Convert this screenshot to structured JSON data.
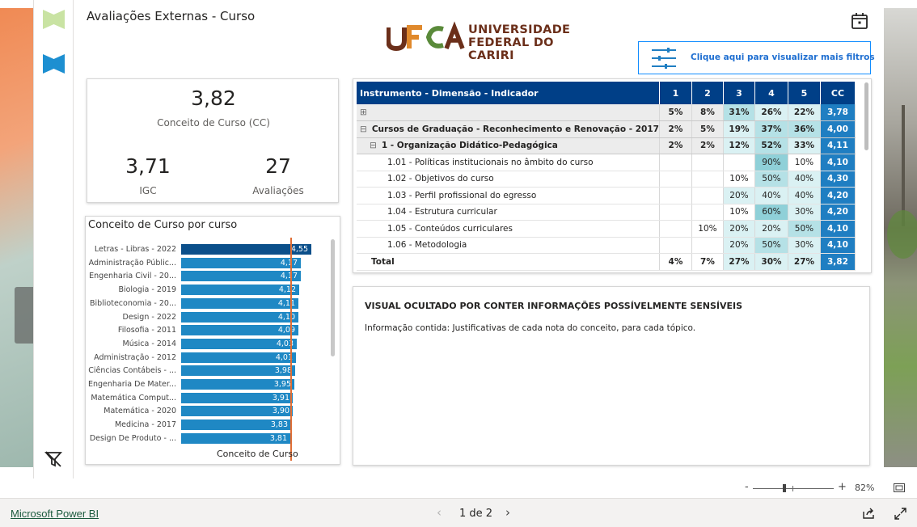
{
  "report": {
    "title": "Avaliações Externas - Curso",
    "logo_text_line1": "UNIVERSIDADE",
    "logo_text_line2": "FEDERAL DO CARIRI",
    "logo_mark": "UFCA",
    "filter_button_label": "Clique aqui para visualizar mais filtros"
  },
  "colors": {
    "primary": "#003f87",
    "bar": "#1f88c4",
    "bar_top": "#0b4f8a",
    "reference_line": "#e06d34",
    "logo_brown": "#6b2f1a",
    "logo_orange": "#e0892c",
    "logo_green": "#5a8a3a"
  },
  "nav": {
    "icons": [
      "bookmark-light-green-icon",
      "bookmark-blue-icon",
      "clear-filter-icon"
    ]
  },
  "kpi": {
    "cc_value": "3,82",
    "cc_label": "Conceito de Curso (CC)",
    "igc_value": "3,71",
    "igc_label": "IGC",
    "avaliacoes_value": "27",
    "avaliacoes_label": "Avaliações"
  },
  "chart_data": {
    "type": "bar",
    "orientation": "horizontal",
    "title": "Conceito de Curso por curso",
    "xlabel": "Conceito de Curso",
    "categories": [
      "Letras - Libras - 2022",
      "Administração Públic...",
      "Engenharia Civil - 20...",
      "Biologia - 2019",
      "Biblioteconomia - 20...",
      "Design - 2022",
      "Filosofia - 2011",
      "Música - 2014",
      "Administração - 2012",
      "Ciências Contábeis - ...",
      "Engenharia De Mater...",
      "Matemática Comput...",
      "Matemática - 2020",
      "Medicina - 2017",
      "Design De Produto - ..."
    ],
    "values": [
      4.55,
      4.17,
      4.17,
      4.12,
      4.11,
      4.1,
      4.09,
      4.03,
      4.01,
      3.98,
      3.95,
      3.91,
      3.9,
      3.83,
      3.81
    ],
    "value_labels": [
      "4,55",
      "4,17",
      "4,17",
      "4,12",
      "4,11",
      "4,10",
      "4,09",
      "4,03",
      "4,01",
      "3,98",
      "3,95",
      "3,91",
      "3,90",
      "3,83",
      "3,81"
    ],
    "reference_line": 3.82,
    "xlim": [
      0,
      4.55
    ]
  },
  "matrix": {
    "headers": [
      "Instrumento - Dimensão - Indicador",
      "1",
      "2",
      "3",
      "4",
      "5",
      "CC"
    ],
    "rows": [
      {
        "kind": "grp",
        "label": "",
        "toggle": "⊞",
        "cells": [
          "5%",
          "8%",
          "31%",
          "26%",
          "22%"
        ],
        "heat": [
          "",
          "",
          "h2",
          "h1",
          "h1"
        ],
        "cc": "3,78"
      },
      {
        "kind": "grp",
        "label": "Cursos de Graduação - Reconhecimento e Renovação - 2017",
        "toggle": "⊟",
        "cells": [
          "2%",
          "5%",
          "19%",
          "37%",
          "36%"
        ],
        "heat": [
          "",
          "",
          "h1",
          "h2",
          "h2"
        ],
        "cc": "4,00"
      },
      {
        "kind": "grp",
        "label": "1 - Organização Didático-Pedagógica",
        "toggle": "⊟",
        "cells": [
          "2%",
          "2%",
          "12%",
          "52%",
          "33%"
        ],
        "heat": [
          "",
          "",
          "h1",
          "h2",
          "h1"
        ],
        "cc": "4,11"
      },
      {
        "kind": "leaf",
        "label": "1.01 - Políticas institucionais no âmbito do curso",
        "cells": [
          "",
          "",
          "",
          "90%",
          "10%"
        ],
        "heat": [
          "",
          "",
          "",
          "h3",
          ""
        ],
        "cc": "4,10"
      },
      {
        "kind": "leaf",
        "label": "1.02 - Objetivos do curso",
        "cells": [
          "",
          "",
          "10%",
          "50%",
          "40%"
        ],
        "heat": [
          "",
          "",
          "",
          "h2",
          "h1"
        ],
        "cc": "4,30"
      },
      {
        "kind": "leaf",
        "label": "1.03 - Perfil profissional do egresso",
        "cells": [
          "",
          "",
          "20%",
          "40%",
          "40%"
        ],
        "heat": [
          "",
          "",
          "h1",
          "h1",
          "h1"
        ],
        "cc": "4,20"
      },
      {
        "kind": "leaf",
        "label": "1.04 - Estrutura curricular",
        "cells": [
          "",
          "",
          "10%",
          "60%",
          "30%"
        ],
        "heat": [
          "",
          "",
          "",
          "h3",
          "h1"
        ],
        "cc": "4,20"
      },
      {
        "kind": "leaf",
        "label": "1.05 - Conteúdos curriculares",
        "cells": [
          "",
          "10%",
          "20%",
          "20%",
          "50%"
        ],
        "heat": [
          "",
          "",
          "h1",
          "h1",
          "h2"
        ],
        "cc": "4,10"
      },
      {
        "kind": "leaf",
        "label": "1.06 - Metodologia",
        "cells": [
          "",
          "",
          "20%",
          "50%",
          "30%"
        ],
        "heat": [
          "",
          "",
          "h1",
          "h2",
          "h1"
        ],
        "cc": "4,10"
      }
    ],
    "total": {
      "label": "Total",
      "cells": [
        "4%",
        "7%",
        "27%",
        "30%",
        "27%"
      ],
      "heat": [
        "",
        "",
        "h1",
        "h1",
        "h1"
      ],
      "cc": "3,82"
    }
  },
  "hidden_visual": {
    "title": "VISUAL OCULTADO POR CONTER INFORMAÇÕES POSSÍVELMENTE SENSÍVEIS",
    "text": "Informação contida: Justificativas de cada nota do conceito, para cada tópico."
  },
  "zoom": {
    "minus": "-",
    "plus": "+",
    "percent": "82%",
    "level": 0.82
  },
  "footer": {
    "brand": "Microsoft Power BI",
    "prev": "‹",
    "page_indicator": "1 de 2",
    "next": "›"
  }
}
